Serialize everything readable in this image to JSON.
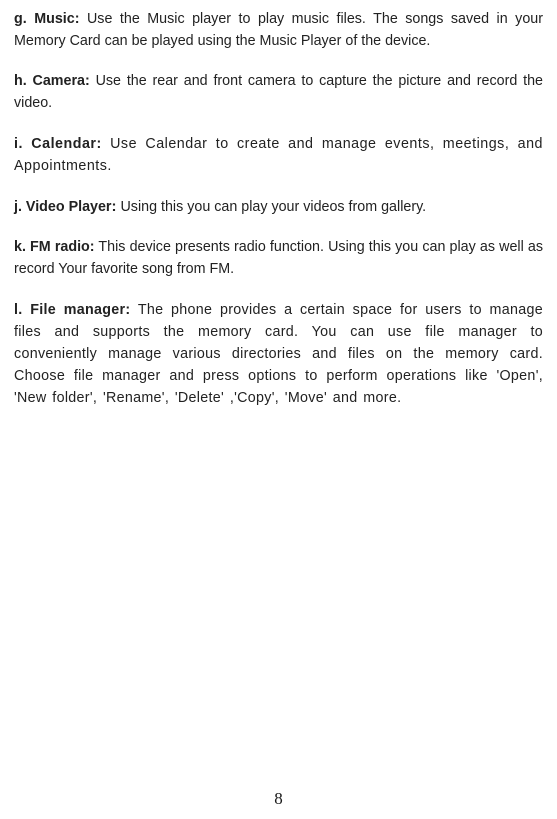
{
  "sections": {
    "g": {
      "label": "g. Music:",
      "text": " Use the Music player to play music files. The songs saved in your Memory Card can be played using the Music Player of the device."
    },
    "h": {
      "label": "h. Camera:",
      "text": " Use the rear and front camera to capture the picture and record the video."
    },
    "i": {
      "label": "i. Calendar:",
      "text": " Use Calendar to create and manage events, meetings, and Appointments."
    },
    "j": {
      "label_prefix": "j.",
      "label_main": " Video Player",
      "label_colon": ":",
      "text": " Using this you can play your videos from gallery."
    },
    "k": {
      "label": "k. FM radio:",
      "text": " This device presents radio function. Using this you can play as well as record Your favorite song from FM."
    },
    "l": {
      "label": "l. File manager:",
      "text": " The phone provides a certain space for users to manage files and supports the memory card. You can use file manager to conveniently manage various directories and files on the memory card. Choose file manager and press options to perform operations like 'Open', 'New folder', 'Rename', 'Delete' ,'Copy', 'Move' and more."
    }
  },
  "page_number": "8"
}
